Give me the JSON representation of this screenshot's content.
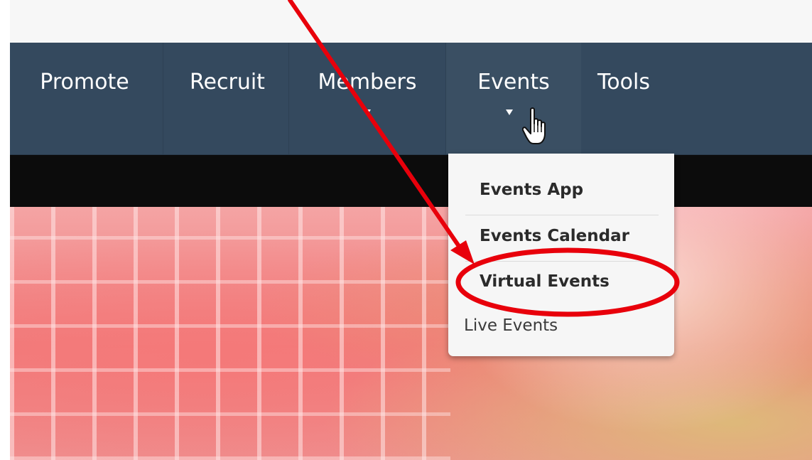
{
  "nav": {
    "items": [
      {
        "label": "Promote",
        "has_caret": false
      },
      {
        "label": "Recruit",
        "has_caret": false
      },
      {
        "label": "Members",
        "has_caret": true
      },
      {
        "label": "Events",
        "has_caret": true
      },
      {
        "label": "Tools",
        "has_caret": false
      }
    ]
  },
  "dropdown": {
    "items": [
      {
        "label": "Events App"
      },
      {
        "label": "Events Calendar"
      },
      {
        "label": "Virtual Events"
      },
      {
        "label": "Live Events"
      }
    ]
  },
  "colors": {
    "navbar": "#34495e",
    "annotation": "#e8000b",
    "dropdown_bg": "#f6f6f6"
  },
  "icons": {
    "cursor": "hand-pointer-icon",
    "caret": "caret-down-icon"
  }
}
